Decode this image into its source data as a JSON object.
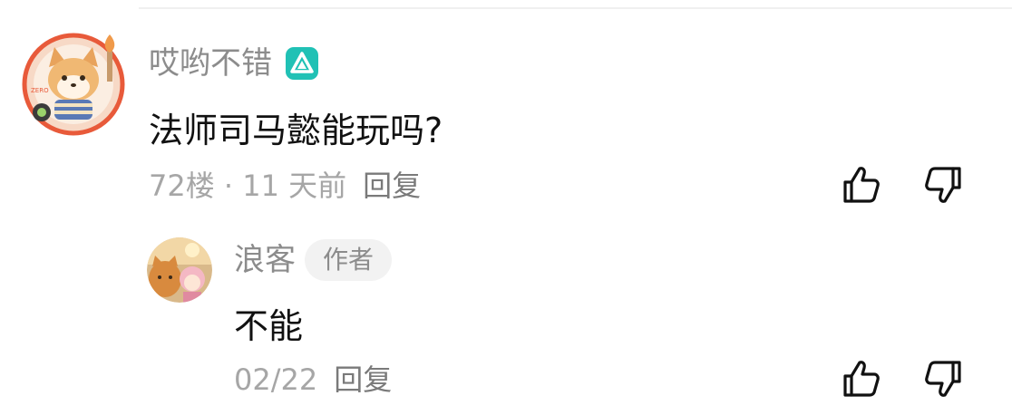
{
  "comment": {
    "author": "哎哟不错",
    "text": "法师司马懿能玩吗?",
    "floor": "72楼",
    "separator": " · ",
    "time": "11 天前",
    "reply_label": "回复",
    "avatar_badge_text": "ZERO",
    "icons": {
      "badge": "verified-triangle-icon",
      "like": "thumbs-up-icon",
      "dislike": "thumbs-down-icon"
    }
  },
  "reply": {
    "author": "浪客",
    "author_tag": "作者",
    "text": "不能",
    "date": "02/22",
    "reply_label": "回复",
    "icons": {
      "like": "thumbs-up-icon",
      "dislike": "thumbs-down-icon"
    }
  },
  "colors": {
    "badge_teal": "#20c1b5",
    "avatar_ring": "#e85a3a",
    "text_primary": "#111111",
    "text_secondary": "#8c8c8c"
  }
}
